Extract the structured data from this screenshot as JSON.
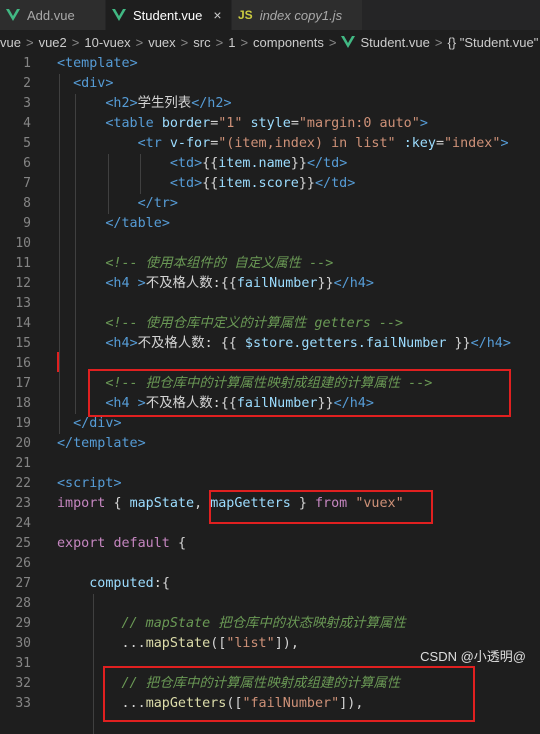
{
  "tabs": [
    {
      "label": "Add.vue",
      "icon": "vue-icon",
      "active": false
    },
    {
      "label": "Student.vue",
      "icon": "vue-icon",
      "active": true,
      "close": "×"
    },
    {
      "label": "index copy1.js",
      "icon": "JS",
      "active": false
    }
  ],
  "breadcrumb": [
    "vue",
    "vue2",
    "10-vuex",
    "vuex",
    "src",
    "1",
    "components",
    "Student.vue",
    "{} \"Student.vue\""
  ],
  "breadcrumb_sep": ">",
  "code_lines": [
    {
      "n": "1",
      "text": "<template>"
    },
    {
      "n": "2",
      "text": "  <div>"
    },
    {
      "n": "3",
      "text": "      <h2>学生列表</h2>"
    },
    {
      "n": "4",
      "text": "      <table border=\"1\" style=\"margin:0 auto\">"
    },
    {
      "n": "5",
      "text": "          <tr v-for=\"(item,index) in list\" :key=\"index\">"
    },
    {
      "n": "6",
      "text": "              <td>{{item.name}}</td>"
    },
    {
      "n": "7",
      "text": "              <td>{{item.score}}</td>"
    },
    {
      "n": "8",
      "text": "          </tr>"
    },
    {
      "n": "9",
      "text": "      </table>"
    },
    {
      "n": "10",
      "text": ""
    },
    {
      "n": "11",
      "text": "      <!-- 使用本组件的 自定义属性 -->"
    },
    {
      "n": "12",
      "text": "      <h4 >不及格人数:{{failNumber}}</h4>"
    },
    {
      "n": "13",
      "text": ""
    },
    {
      "n": "14",
      "text": "      <!-- 使用仓库中定义的计算属性 getters -->"
    },
    {
      "n": "15",
      "text": "      <h4>不及格人数: {{ $store.getters.failNumber }}</h4>"
    },
    {
      "n": "16",
      "text": ""
    },
    {
      "n": "17",
      "text": "      <!-- 把仓库中的计算属性映射成组建的计算属性 -->"
    },
    {
      "n": "18",
      "text": "      <h4 >不及格人数:{{failNumber}}</h4>"
    },
    {
      "n": "19",
      "text": "  </div>"
    },
    {
      "n": "20",
      "text": "</template>"
    },
    {
      "n": "21",
      "text": ""
    },
    {
      "n": "22",
      "text": "<script>"
    },
    {
      "n": "23",
      "text": "import { mapState, mapGetters } from \"vuex\""
    },
    {
      "n": "24",
      "text": ""
    },
    {
      "n": "25",
      "text": "export default {"
    },
    {
      "n": "26",
      "text": ""
    },
    {
      "n": "27",
      "text": "    computed:{"
    },
    {
      "n": "28",
      "text": ""
    },
    {
      "n": "29",
      "text": "        // mapState 把仓库中的状态映射成计算属性"
    },
    {
      "n": "30",
      "text": "        ...mapState([\"list\"]),"
    },
    {
      "n": "31",
      "text": ""
    },
    {
      "n": "32",
      "text": "        // 把仓库中的计算属性映射成组建的计算属性"
    },
    {
      "n": "33",
      "text": "        ...mapGetters([\"failNumber\"]),"
    }
  ],
  "watermark": "CSDN @小透明@",
  "colors": {
    "background": "#1e1e1e",
    "highlight_box": "#e02020",
    "tag": "#569cd6",
    "attr": "#9cdcfe",
    "string": "#ce9178",
    "comment": "#6a9955",
    "keyword": "#c586c0",
    "function": "#dcdcaa"
  }
}
